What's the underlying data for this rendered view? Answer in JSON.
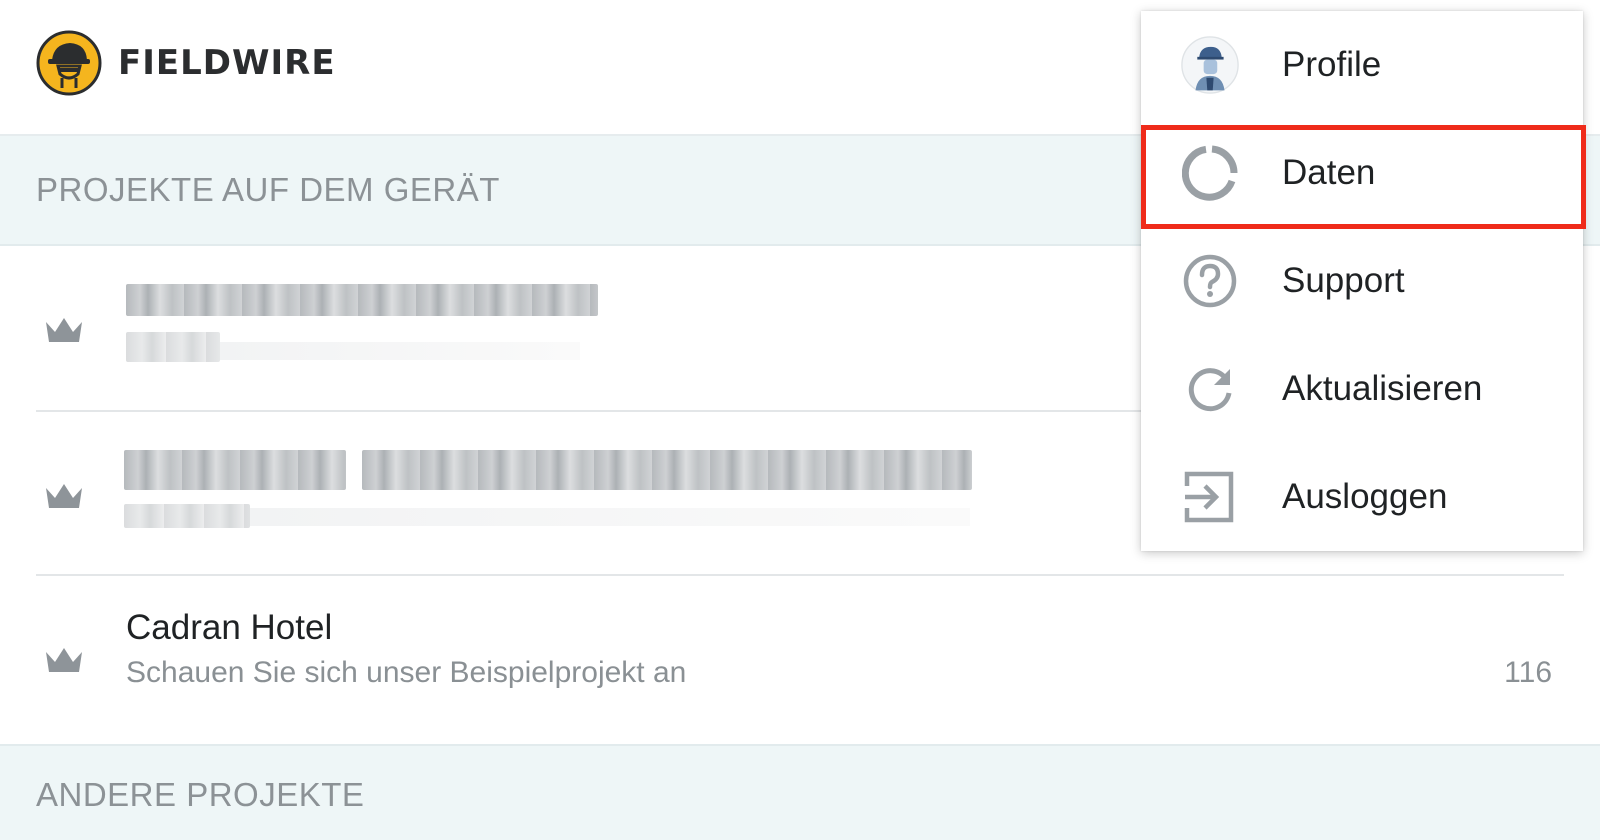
{
  "header": {
    "logo_text": "FIELDWIRE",
    "logo_icon": "fieldwire-worker-logo-icon",
    "accent_color": "#f5b51e"
  },
  "sections": {
    "on_device": "PROJEKTE AUF DEM GERÄT",
    "other": "ANDERE PROJEKTE"
  },
  "projects": [
    {
      "title": "",
      "subtitle": "",
      "count": "",
      "blurred": true,
      "icon": "crown-icon"
    },
    {
      "title": "",
      "subtitle": "",
      "count": "",
      "blurred": true,
      "icon": "crown-icon"
    },
    {
      "title": "Cadran Hotel",
      "subtitle": "Schauen Sie sich unser Beispielprojekt an",
      "count": "116",
      "blurred": false,
      "icon": "crown-icon"
    }
  ],
  "menu": {
    "items": [
      {
        "label": "Profile",
        "icon": "avatar-icon"
      },
      {
        "label": "Daten",
        "icon": "data-usage-icon",
        "highlighted": true
      },
      {
        "label": "Support",
        "icon": "help-circle-icon"
      },
      {
        "label": "Aktualisieren",
        "icon": "refresh-icon"
      },
      {
        "label": "Ausloggen",
        "icon": "logout-icon"
      }
    ],
    "highlight_color": "#ef2b1a"
  }
}
